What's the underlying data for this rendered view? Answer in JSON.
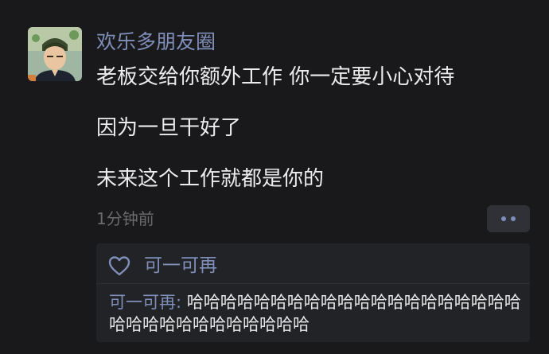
{
  "post": {
    "username": "欢乐多朋友圈",
    "lines": [
      "老板交给你额外工作 你一定要小心对待",
      "因为一旦干好了",
      "未来这个工作就都是你的"
    ],
    "time": "1分钟前"
  },
  "likes": {
    "names": "可一可再"
  },
  "comment": {
    "author": "可一可再",
    "separator": ": ",
    "text": "哈哈哈哈哈哈哈哈哈哈哈哈哈哈哈哈哈哈哈哈哈哈哈哈哈哈哈哈哈哈哈哈"
  },
  "colors": {
    "background": "#19191b",
    "name_blue": "#7f8fb9",
    "panel": "#222326"
  }
}
